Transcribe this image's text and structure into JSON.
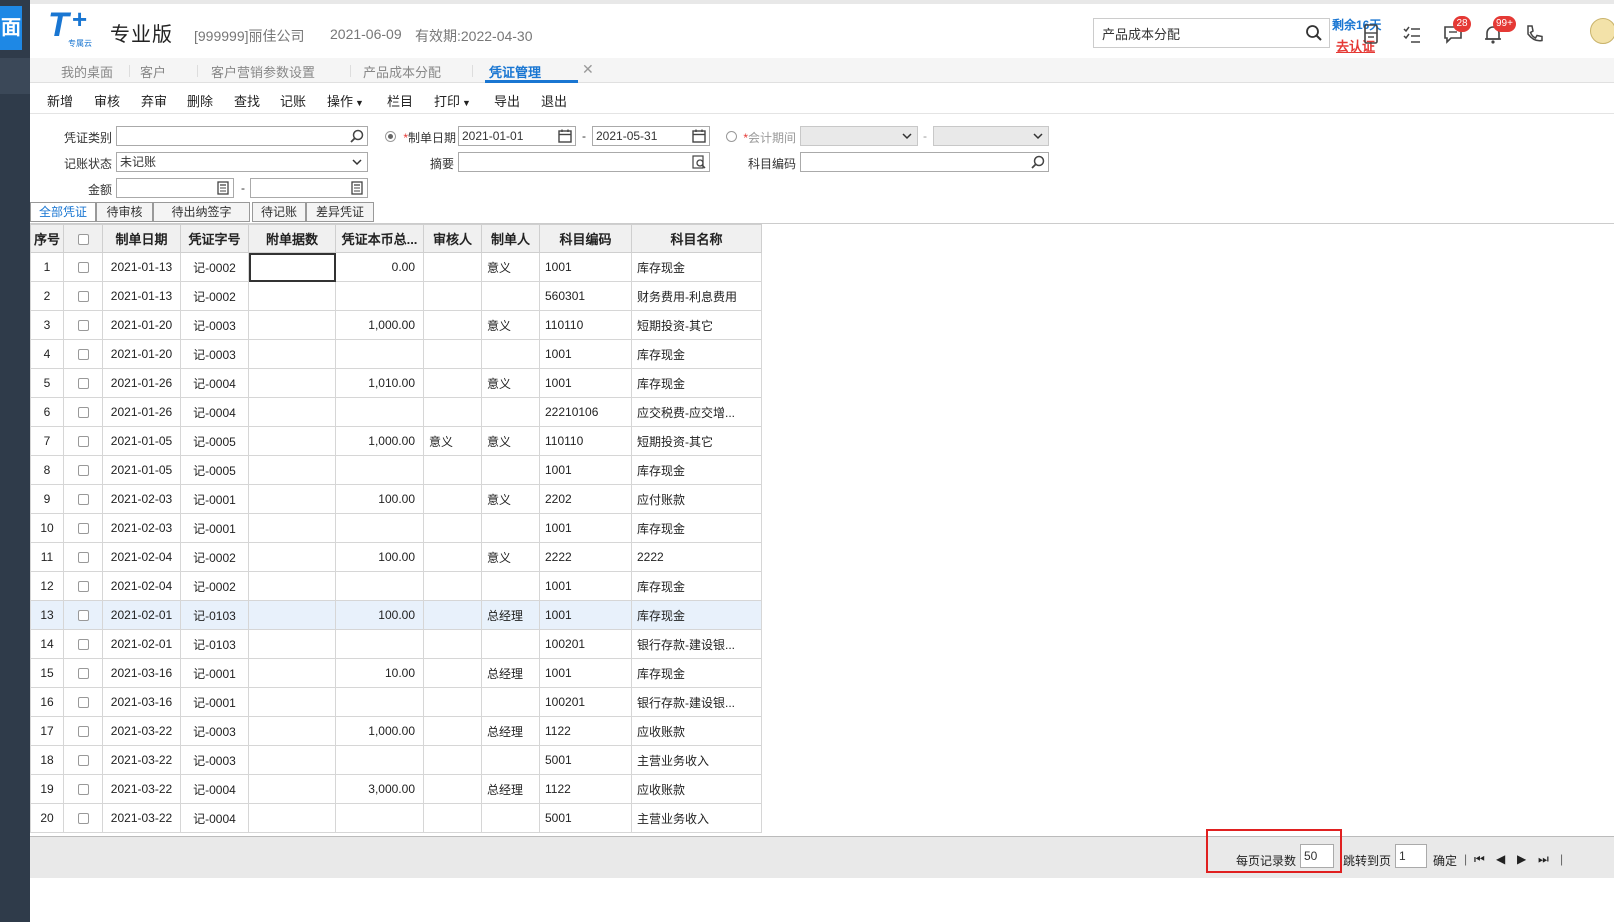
{
  "sidebar": {
    "home_char": "面"
  },
  "header": {
    "logo_text": "T",
    "logo_sub": "专属云",
    "edition": "专业版",
    "company": "[999999]丽佳公司",
    "date": "2021-06-09",
    "validity": "有效期:2022-04-30",
    "search_value": "产品成本分配",
    "remaining": "剩余16天",
    "verify_link": "去认证",
    "badge_messages": "28",
    "badge_notifications": "99+"
  },
  "tabs": [
    {
      "label": "我的桌面"
    },
    {
      "label": "客户"
    },
    {
      "label": "客户营销参数设置"
    },
    {
      "label": "产品成本分配"
    },
    {
      "label": "凭证管理"
    }
  ],
  "toolbar": [
    "新增",
    "审核",
    "弃审",
    "删除",
    "查找",
    "记账",
    "操作",
    "栏目",
    "打印",
    "导出",
    "退出"
  ],
  "filters": {
    "voucher_type_label": "凭证类别",
    "voucher_type_value": "",
    "posting_status_label": "记账状态",
    "posting_status_value": "未记账",
    "amount_label": "金额",
    "dash": "-",
    "date_label": "制单日期",
    "date_from": "2021-01-01",
    "date_to": "2021-05-31",
    "summary_label": "摘要",
    "period_label": "会计期间",
    "account_code_label": "科目编码",
    "required_mark": "*"
  },
  "quick_filters": [
    "全部凭证",
    "待审核",
    "待出纳签字",
    "待记账",
    "差异凭证"
  ],
  "grid": {
    "columns": [
      "序号",
      "",
      "制单日期",
      "凭证字号",
      "附单据数",
      "凭证本币总...",
      "审核人",
      "制单人",
      "科目编码",
      "科目名称"
    ],
    "rows": [
      {
        "no": "1",
        "date": "2021-01-13",
        "voucher": "记-0002",
        "total": "0.00",
        "auditor": "",
        "maker": "意义",
        "code": "1001",
        "name": "库存现金"
      },
      {
        "no": "2",
        "date": "2021-01-13",
        "voucher": "记-0002",
        "total": "",
        "auditor": "",
        "maker": "",
        "code": "560301",
        "name": "财务费用-利息费用"
      },
      {
        "no": "3",
        "date": "2021-01-20",
        "voucher": "记-0003",
        "total": "1,000.00",
        "auditor": "",
        "maker": "意义",
        "code": "110110",
        "name": "短期投资-其它"
      },
      {
        "no": "4",
        "date": "2021-01-20",
        "voucher": "记-0003",
        "total": "",
        "auditor": "",
        "maker": "",
        "code": "1001",
        "name": "库存现金"
      },
      {
        "no": "5",
        "date": "2021-01-26",
        "voucher": "记-0004",
        "total": "1,010.00",
        "auditor": "",
        "maker": "意义",
        "code": "1001",
        "name": "库存现金"
      },
      {
        "no": "6",
        "date": "2021-01-26",
        "voucher": "记-0004",
        "total": "",
        "auditor": "",
        "maker": "",
        "code": "22210106",
        "name": "应交税费-应交增..."
      },
      {
        "no": "7",
        "date": "2021-01-05",
        "voucher": "记-0005",
        "total": "1,000.00",
        "auditor": "意义",
        "maker": "意义",
        "code": "110110",
        "name": "短期投资-其它"
      },
      {
        "no": "8",
        "date": "2021-01-05",
        "voucher": "记-0005",
        "total": "",
        "auditor": "",
        "maker": "",
        "code": "1001",
        "name": "库存现金"
      },
      {
        "no": "9",
        "date": "2021-02-03",
        "voucher": "记-0001",
        "total": "100.00",
        "auditor": "",
        "maker": "意义",
        "code": "2202",
        "name": "应付账款"
      },
      {
        "no": "10",
        "date": "2021-02-03",
        "voucher": "记-0001",
        "total": "",
        "auditor": "",
        "maker": "",
        "code": "1001",
        "name": "库存现金"
      },
      {
        "no": "11",
        "date": "2021-02-04",
        "voucher": "记-0002",
        "total": "100.00",
        "auditor": "",
        "maker": "意义",
        "code": "2222",
        "name": "2222"
      },
      {
        "no": "12",
        "date": "2021-02-04",
        "voucher": "记-0002",
        "total": "",
        "auditor": "",
        "maker": "",
        "code": "1001",
        "name": "库存现金"
      },
      {
        "no": "13",
        "date": "2021-02-01",
        "voucher": "记-0103",
        "total": "100.00",
        "auditor": "",
        "maker": "总经理",
        "code": "1001",
        "name": "库存现金"
      },
      {
        "no": "14",
        "date": "2021-02-01",
        "voucher": "记-0103",
        "total": "",
        "auditor": "",
        "maker": "",
        "code": "100201",
        "name": "银行存款-建设银..."
      },
      {
        "no": "15",
        "date": "2021-03-16",
        "voucher": "记-0001",
        "total": "10.00",
        "auditor": "",
        "maker": "总经理",
        "code": "1001",
        "name": "库存现金"
      },
      {
        "no": "16",
        "date": "2021-03-16",
        "voucher": "记-0001",
        "total": "",
        "auditor": "",
        "maker": "",
        "code": "100201",
        "name": "银行存款-建设银..."
      },
      {
        "no": "17",
        "date": "2021-03-22",
        "voucher": "记-0003",
        "total": "1,000.00",
        "auditor": "",
        "maker": "总经理",
        "code": "1122",
        "name": "应收账款"
      },
      {
        "no": "18",
        "date": "2021-03-22",
        "voucher": "记-0003",
        "total": "",
        "auditor": "",
        "maker": "",
        "code": "5001",
        "name": "主营业务收入"
      },
      {
        "no": "19",
        "date": "2021-03-22",
        "voucher": "记-0004",
        "total": "3,000.00",
        "auditor": "",
        "maker": "总经理",
        "code": "1122",
        "name": "应收账款"
      },
      {
        "no": "20",
        "date": "2021-03-22",
        "voucher": "记-0004",
        "total": "",
        "auditor": "",
        "maker": "",
        "code": "5001",
        "name": "主营业务收入"
      }
    ]
  },
  "footer": {
    "per_page_label": "每页记录数",
    "per_page_value": "50",
    "jump_label": "跳转到页",
    "jump_value": "1",
    "confirm": "确定"
  },
  "colors": {
    "accent": "#1976d2",
    "badge": "#e53935",
    "highlight_box": "#e02020"
  }
}
